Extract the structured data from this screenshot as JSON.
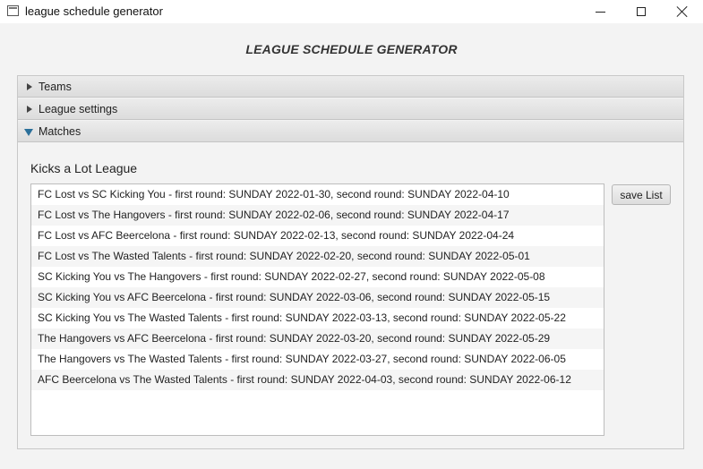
{
  "window": {
    "title": "league schedule generator"
  },
  "app": {
    "heading": "LEAGUE SCHEDULE GENERATOR"
  },
  "accordion": {
    "panes": [
      {
        "label": "Teams",
        "expanded": false
      },
      {
        "label": "League settings",
        "expanded": false
      },
      {
        "label": "Matches",
        "expanded": true
      }
    ]
  },
  "matches": {
    "league_name": "Kicks a Lot League",
    "save_label": "save List",
    "rows": [
      "FC Lost vs SC Kicking You -  first round: SUNDAY 2022-01-30, second round: SUNDAY 2022-04-10",
      "FC Lost vs The Hangovers -  first round: SUNDAY 2022-02-06, second round: SUNDAY 2022-04-17",
      "FC Lost vs AFC Beercelona -  first round: SUNDAY 2022-02-13, second round: SUNDAY 2022-04-24",
      "FC Lost vs The Wasted Talents -  first round: SUNDAY 2022-02-20, second round: SUNDAY 2022-05-01",
      "SC Kicking You vs The Hangovers -  first round: SUNDAY 2022-02-27, second round: SUNDAY 2022-05-08",
      "SC Kicking You vs AFC Beercelona -  first round: SUNDAY 2022-03-06, second round: SUNDAY 2022-05-15",
      "SC Kicking You vs The Wasted Talents -  first round: SUNDAY 2022-03-13, second round: SUNDAY 2022-05-22",
      "The Hangovers vs AFC Beercelona -  first round: SUNDAY 2022-03-20, second round: SUNDAY 2022-05-29",
      "The Hangovers vs The Wasted Talents -  first round: SUNDAY 2022-03-27, second round: SUNDAY 2022-06-05",
      "AFC Beercelona vs The Wasted Talents -  first round: SUNDAY 2022-04-03, second round: SUNDAY 2022-06-12"
    ]
  },
  "colors": {
    "accent_arrow": "#2a6f9a",
    "window_bg": "#f3f3f3"
  }
}
